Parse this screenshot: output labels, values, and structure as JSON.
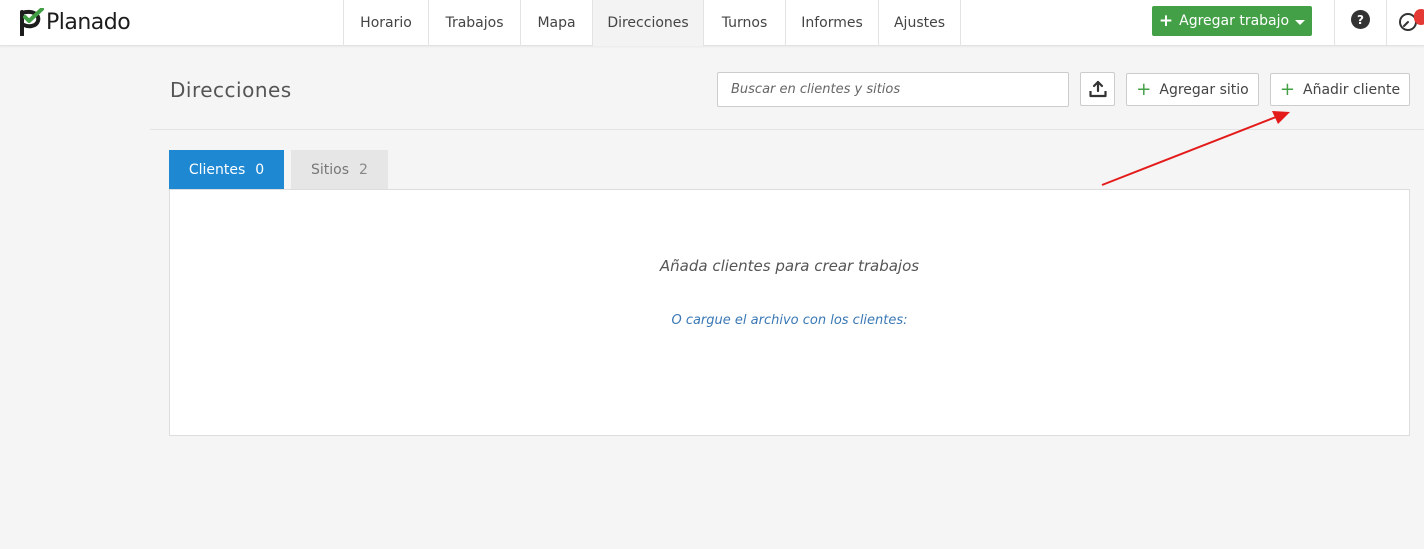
{
  "brand": {
    "name": "Planado",
    "accent": "#43a047"
  },
  "nav": [
    {
      "label": "Horario",
      "active": false
    },
    {
      "label": "Trabajos",
      "active": false
    },
    {
      "label": "Mapa",
      "active": false
    },
    {
      "label": "Direcciones",
      "active": true
    },
    {
      "label": "Turnos",
      "active": false
    },
    {
      "label": "Informes",
      "active": false
    },
    {
      "label": "Ajustes",
      "active": false
    }
  ],
  "topbar": {
    "add_job_label": "Agregar trabajo",
    "help_icon": "question-circle-icon",
    "clock_icon": "clock-icon"
  },
  "page": {
    "title": "Direcciones",
    "search_placeholder": "Buscar en clientes y sitios",
    "upload_icon": "upload-icon",
    "add_site_label": "Agregar sitio",
    "add_client_label": "Añadir cliente"
  },
  "tabs": [
    {
      "label": "Clientes",
      "count": "0",
      "active": true
    },
    {
      "label": "Sitios",
      "count": "2",
      "active": false
    }
  ],
  "empty_state": {
    "message": "Añada clientes para crear trabajos",
    "upload_link": "O cargue el archivo con los clientes:"
  },
  "colors": {
    "tab_active": "#1e88d2",
    "annotation_arrow": "#e41b1b",
    "link": "#3a78b5"
  }
}
